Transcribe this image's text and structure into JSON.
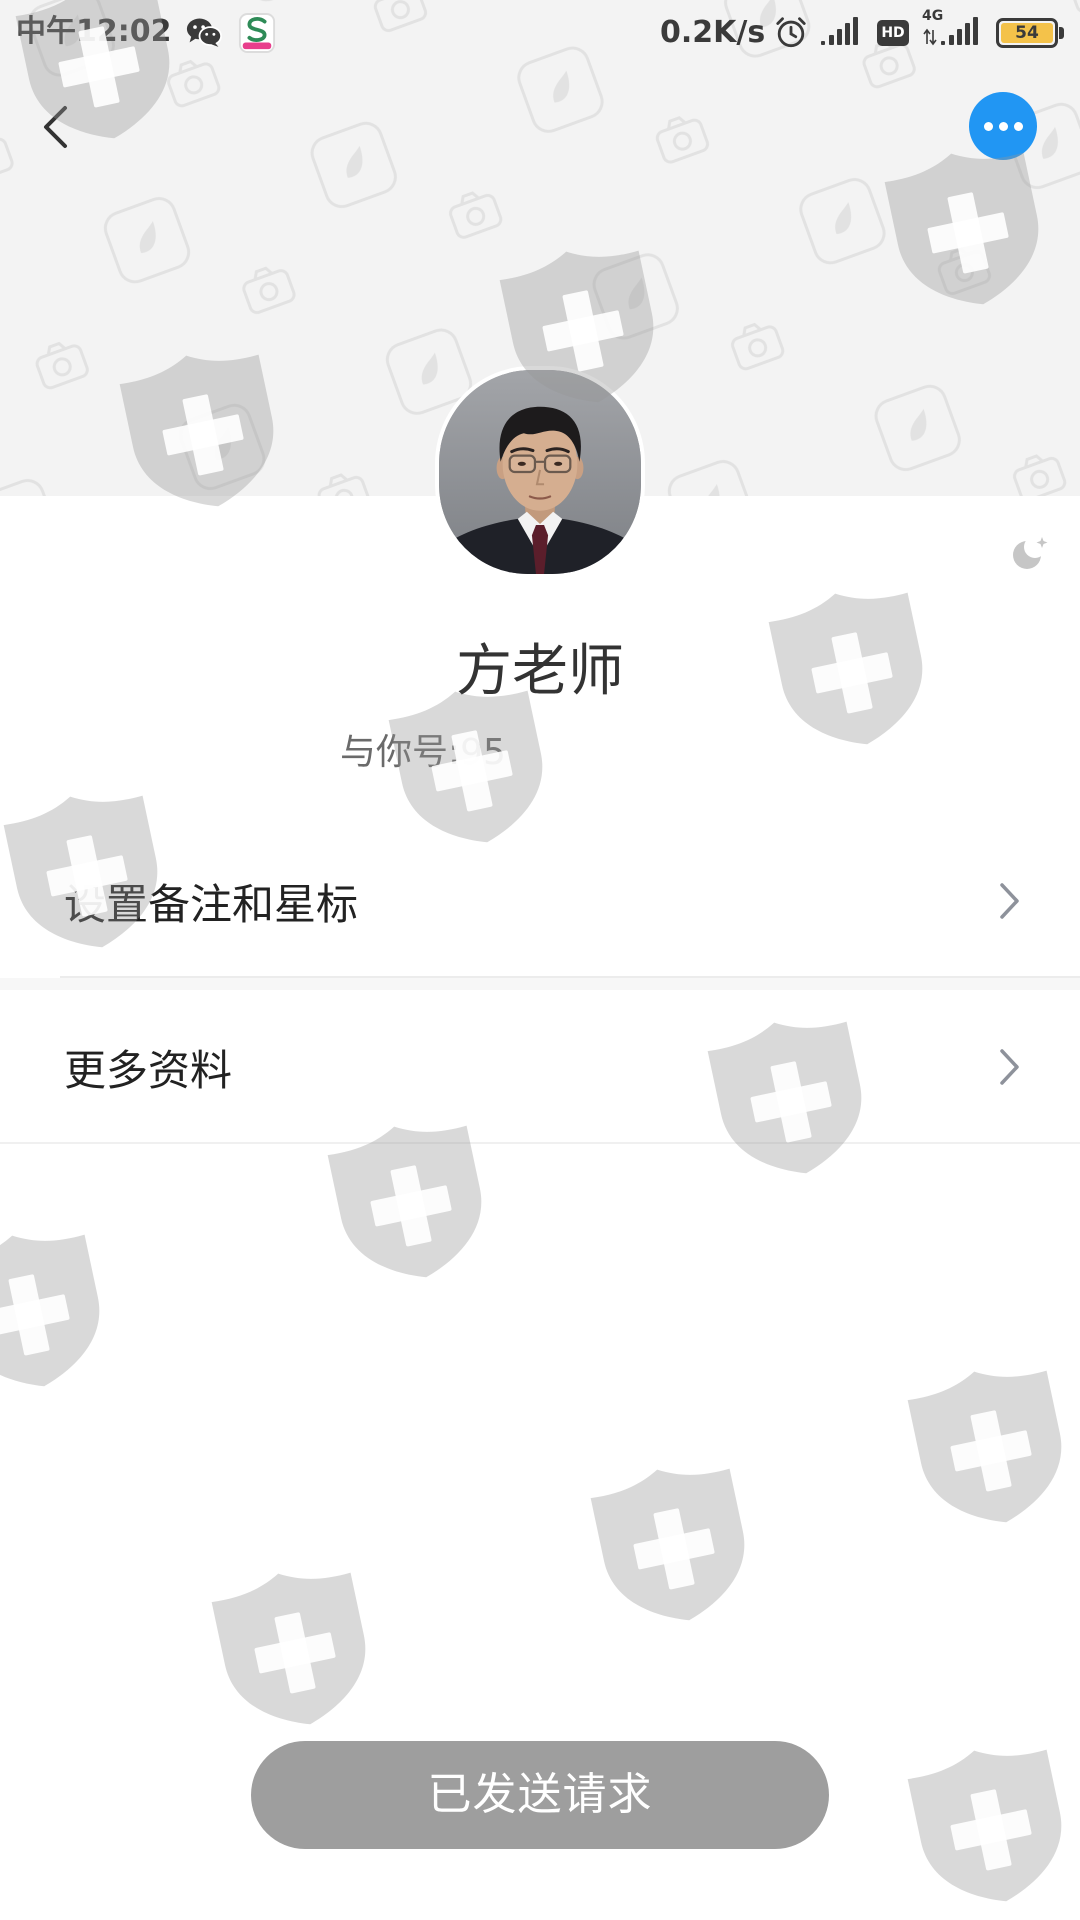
{
  "status_bar": {
    "time": "中午12:02",
    "net_speed": "0.2K/s",
    "hd_badge": "HD",
    "network_type": "4G",
    "battery_level": "54"
  },
  "icons": {
    "status": [
      "wechat-icon",
      "app-notification-icon",
      "alarm-icon",
      "signal-icon",
      "hd-icon",
      "data-arrows-icon",
      "4g-signal-icon",
      "battery-icon"
    ],
    "nav": [
      "chevron-left-icon",
      "more-dots-icon"
    ],
    "profile": [
      "moon-icon"
    ],
    "menu": "chevron-right-icon",
    "watermark": "shield-cross-icon"
  },
  "profile": {
    "name": "方老师",
    "account_text": "与你号:95"
  },
  "menu": {
    "items": [
      {
        "label": "设置备注和星标"
      },
      {
        "label": "更多资料"
      }
    ]
  },
  "action_button": {
    "label": "已发送请求"
  },
  "colors": {
    "accent": "#2196f3",
    "header_bg": "#f3f3f3",
    "button_bg": "#9e9e9e",
    "battery_fill": "#f4c24a",
    "text_primary": "#222222",
    "text_secondary": "#6a6a6a"
  }
}
